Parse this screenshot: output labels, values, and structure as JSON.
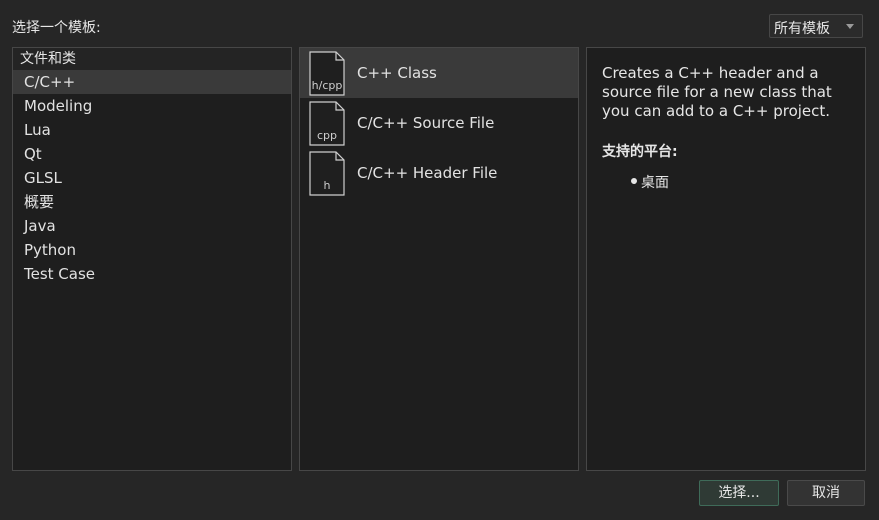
{
  "dialog": {
    "prompt": "选择一个模板:"
  },
  "filter": {
    "value": "所有模板"
  },
  "categories": {
    "header": "文件和类",
    "items": [
      {
        "label": "C/C++",
        "selected": true
      },
      {
        "label": "Modeling",
        "selected": false
      },
      {
        "label": "Lua",
        "selected": false
      },
      {
        "label": "Qt",
        "selected": false
      },
      {
        "label": "GLSL",
        "selected": false
      },
      {
        "label": "概要",
        "selected": false
      },
      {
        "label": "Java",
        "selected": false
      },
      {
        "label": "Python",
        "selected": false
      },
      {
        "label": "Test Case",
        "selected": false
      }
    ]
  },
  "templates": [
    {
      "label": "C++ Class",
      "icon_text": "h/cpp",
      "icon": "file-icon",
      "selected": true
    },
    {
      "label": "C/C++ Source File",
      "icon_text": "cpp",
      "icon": "file-icon",
      "selected": false
    },
    {
      "label": "C/C++ Header File",
      "icon_text": "h",
      "icon": "file-icon",
      "selected": false
    }
  ],
  "details": {
    "description": "Creates a C++ header and a source file for a new class that you can add to a C++ project.",
    "platforms_heading": "支持的平台:",
    "platforms": [
      "桌面"
    ]
  },
  "buttons": {
    "choose": "选择...",
    "cancel": "取消"
  }
}
